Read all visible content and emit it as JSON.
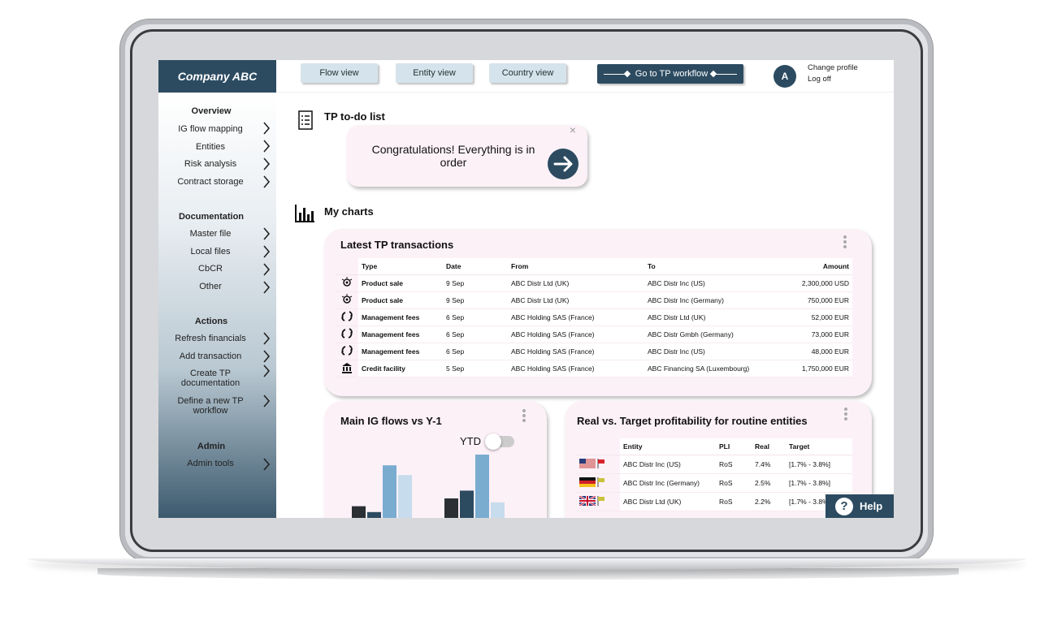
{
  "brand": "Company ABC",
  "top": {
    "views": [
      "Flow view",
      "Entity view",
      "Country view"
    ],
    "workflow": "Go to TP workflow",
    "avatar": "A",
    "change_profile": "Change profile",
    "log_off": "Log off"
  },
  "sidebar": {
    "overview": {
      "title": "Overview",
      "items": [
        "IG flow mapping",
        "Entities",
        "Risk analysis",
        "Contract storage"
      ]
    },
    "documentation": {
      "title": "Documentation",
      "items": [
        "Master file",
        "Local files",
        "CbCR",
        "Other"
      ]
    },
    "actions": {
      "title": "Actions",
      "items": [
        "Refresh financials",
        "Add transaction",
        "Create TP documentation",
        "Define a new TP workflow"
      ]
    },
    "admin": {
      "title": "Admin",
      "items": [
        "Admin tools"
      ]
    }
  },
  "todo": {
    "title": "TP to-do list",
    "message": "Congratulations! Everything is in order",
    "close": "×"
  },
  "charts": {
    "title": "My charts"
  },
  "transactions": {
    "title": "Latest TP transactions",
    "columns": [
      "Type",
      "Date",
      "From",
      "To",
      "Amount"
    ],
    "rows": [
      [
        "Product sale",
        "9 Sep",
        "ABC Distr Ltd (UK)",
        "ABC Distr Inc (US)",
        "2,300,000 USD"
      ],
      [
        "Product sale",
        "9 Sep",
        "ABC Distr Ltd (UK)",
        "ABC Distr Inc (Germany)",
        "750,000 EUR"
      ],
      [
        "Management fees",
        "6 Sep",
        "ABC Holding SAS (France)",
        "ABC Distr Ltd (UK)",
        "52,000 EUR"
      ],
      [
        "Management fees",
        "6 Sep",
        "ABC Holding SAS (France)",
        "ABC Distr Gmbh (Germany)",
        "73,000 EUR"
      ],
      [
        "Management fees",
        "6 Sep",
        "ABC Holding SAS (France)",
        "ABC Distr Inc (US)",
        "48,000 EUR"
      ],
      [
        "Credit facility",
        "5 Sep",
        "ABC Holding SAS (France)",
        "ABC Financing SA (Luxembourg)",
        "1,750,000 EUR"
      ]
    ],
    "icons": [
      "product-icon",
      "product-icon",
      "recycle-icon",
      "recycle-icon",
      "recycle-icon",
      "bank-icon"
    ]
  },
  "flows": {
    "title": "Main IG flows vs Y-1",
    "toggle_label": "YTD",
    "chart_data": {
      "type": "bar",
      "title": "Main IG flows vs Y-1",
      "series": [
        {
          "values": [
            12,
            6,
            54,
            44
          ],
          "colors": [
            "#2b2f33",
            "#2c4b61",
            "#7aacd0",
            "#c7dcec"
          ]
        },
        {
          "values": [
            20,
            28,
            65,
            16
          ],
          "colors": [
            "#2b2f33",
            "#2c4b61",
            "#7aacd0",
            "#c7dcec"
          ]
        }
      ]
    }
  },
  "profit": {
    "title": "Real vs. Target profitability for routine entities",
    "columns": [
      "Entity",
      "PLI",
      "Real",
      "Target"
    ],
    "rows": [
      {
        "flag": "us-flag-icon",
        "entity": "ABC Distr Inc (US)",
        "pli": "RoS",
        "real": "7.4%",
        "target": "[1.7% - 3.8%]",
        "status": "#d8232a"
      },
      {
        "flag": "de-flag-icon",
        "entity": "ABC Distr Inc (Germany)",
        "pli": "RoS",
        "real": "2.5%",
        "target": "[1.7% - 3.8%]",
        "status": "#c9c23a"
      },
      {
        "flag": "uk-flag-icon",
        "entity": "ABC Distr Ltd (UK)",
        "pli": "RoS",
        "real": "2.2%",
        "target": "[1.7% - 3.8%]",
        "status": "#c9c23a"
      }
    ]
  },
  "help": "Help"
}
